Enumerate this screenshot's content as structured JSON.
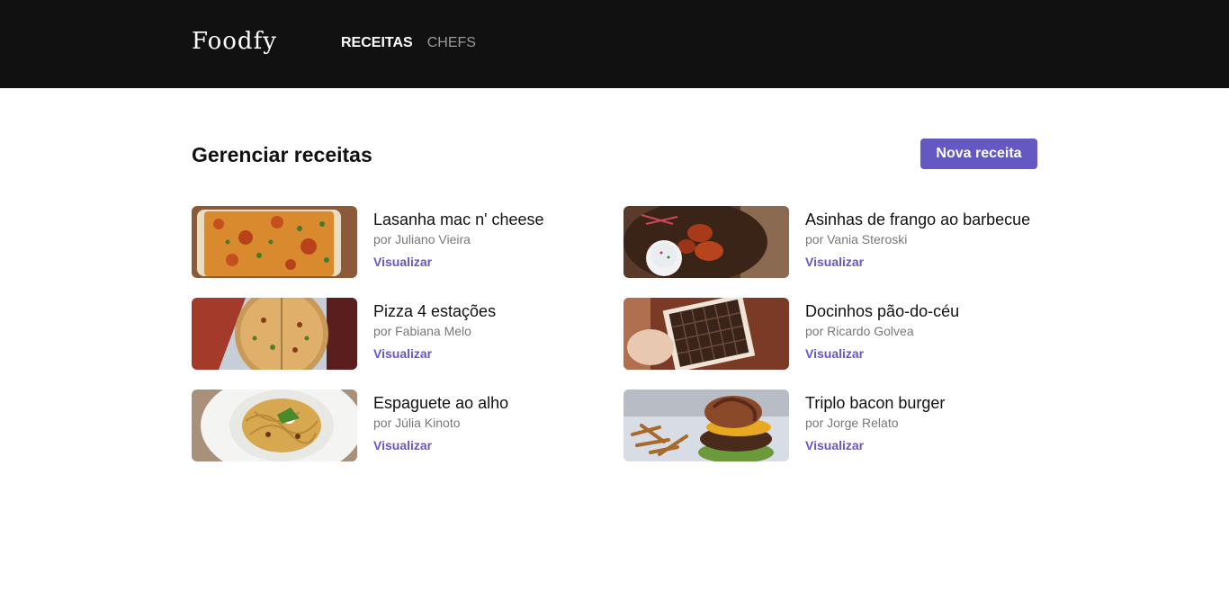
{
  "header": {
    "logo": "Foodfy",
    "nav": [
      {
        "label": "RECEITAS",
        "active": true
      },
      {
        "label": "CHEFS",
        "active": false
      }
    ]
  },
  "main": {
    "title": "Gerenciar receitas",
    "new_button": "Nova receita",
    "recipes": [
      {
        "title": "Lasanha mac n' cheese",
        "author": "por Juliano Vieira",
        "link": "Visualizar",
        "image": "lasagna-photo"
      },
      {
        "title": "Asinhas de frango ao barbecue",
        "author": "por Vania Steroski",
        "link": "Visualizar",
        "image": "chicken-wings-photo"
      },
      {
        "title": "Pizza 4 estações",
        "author": "por Fabiana Melo",
        "link": "Visualizar",
        "image": "pizza-photo"
      },
      {
        "title": "Docinhos pão-do-céu",
        "author": "por Ricardo Golvea",
        "link": "Visualizar",
        "image": "chocolates-photo"
      },
      {
        "title": "Espaguete ao alho",
        "author": "por Júlia Kinoto",
        "link": "Visualizar",
        "image": "spaghetti-photo"
      },
      {
        "title": "Triplo bacon burger",
        "author": "por Jorge Relato",
        "link": "Visualizar",
        "image": "burger-photo"
      }
    ]
  },
  "colors": {
    "accent": "#6558c3",
    "header_bg": "#111111"
  }
}
